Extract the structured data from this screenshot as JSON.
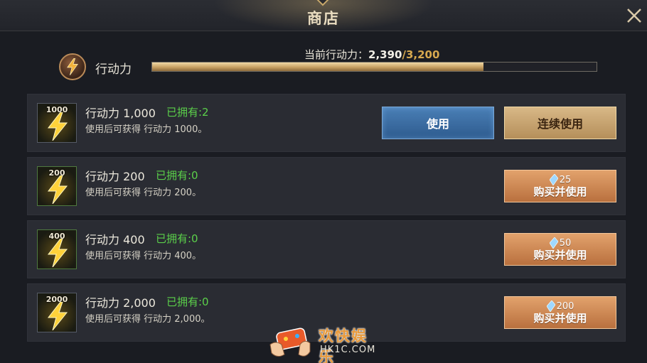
{
  "header": {
    "title": "商店"
  },
  "energy": {
    "label": "行动力",
    "caption_prefix": "当前行动力：",
    "current": "2,390",
    "separator": "/",
    "max": "3,200",
    "fill_fraction": 0.746
  },
  "items": [
    {
      "amount": "1000",
      "name": "行动力 1,000",
      "owned": "已拥有:2",
      "desc": "使用后可获得 行动力 1000。",
      "use_label": "使用",
      "continuous_use_label": "连续使用"
    },
    {
      "amount": "200",
      "name": "行动力 200",
      "owned": "已拥有:0",
      "desc": "使用后可获得 行动力 200。",
      "price": "25",
      "buy_label": "购买并使用"
    },
    {
      "amount": "400",
      "name": "行动力 400",
      "owned": "已拥有:0",
      "desc": "使用后可获得 行动力 400。",
      "price": "50",
      "buy_label": "购买并使用"
    },
    {
      "amount": "2000",
      "name": "行动力 2,000",
      "owned": "已拥有:0",
      "desc": "使用后可获得 行动力 2,000。",
      "price": "200",
      "buy_label": "购买并使用"
    }
  ],
  "watermark": {
    "title": "欢快娱乐",
    "url": "HK1C.COM"
  },
  "icons": {
    "close": "close-icon",
    "energy": "lightning-icon",
    "currency": "crystal-icon"
  },
  "colors": {
    "owned_green": "#5bd04a",
    "max_gold": "#d7a94f",
    "use_blue": "#3a6ea3",
    "buy_orange": "#cf8a52"
  }
}
